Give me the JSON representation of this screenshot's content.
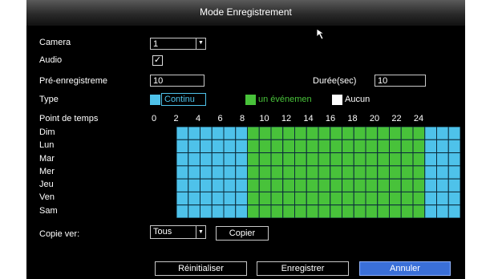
{
  "window": {
    "title": "Mode Enregistrement"
  },
  "form": {
    "camera_label": "Camera",
    "camera_value": "1",
    "audio_label": "Audio",
    "audio_checked": true,
    "pre_label": "Pré-enregistreme",
    "pre_value": "10",
    "duration_label": "Durée(sec)",
    "duration_value": "10",
    "type_label": "Type",
    "types": [
      {
        "label": "Continu",
        "color": "#4ec2ea"
      },
      {
        "label": "un événemen",
        "color": "#48c23a"
      },
      {
        "label": "Aucun",
        "color": "#ffffff"
      }
    ],
    "time_label": "Point de temps",
    "hour_labels": [
      "0",
      "2",
      "4",
      "6",
      "8",
      "10",
      "12",
      "14",
      "16",
      "18",
      "20",
      "22",
      "24"
    ],
    "days": [
      "Dim",
      "Lun",
      "Mar",
      "Mer",
      "Jeu",
      "Ven",
      "Sam"
    ],
    "schedule": {
      "continu_hours": [
        [
          0,
          6
        ],
        [
          21,
          24
        ]
      ],
      "event_hours": [
        [
          6,
          21
        ]
      ]
    },
    "copy_label": "Copie ver:",
    "copy_value": "Tous",
    "copy_button": "Copier"
  },
  "footer": {
    "reset": "Réinitialiser",
    "save": "Enregistrer",
    "cancel": "Annuler"
  },
  "colors": {
    "continu": "#4ec2ea",
    "event": "#48c23a",
    "grid_line": "#0b2a3a",
    "accent": "#3a6fd8"
  }
}
